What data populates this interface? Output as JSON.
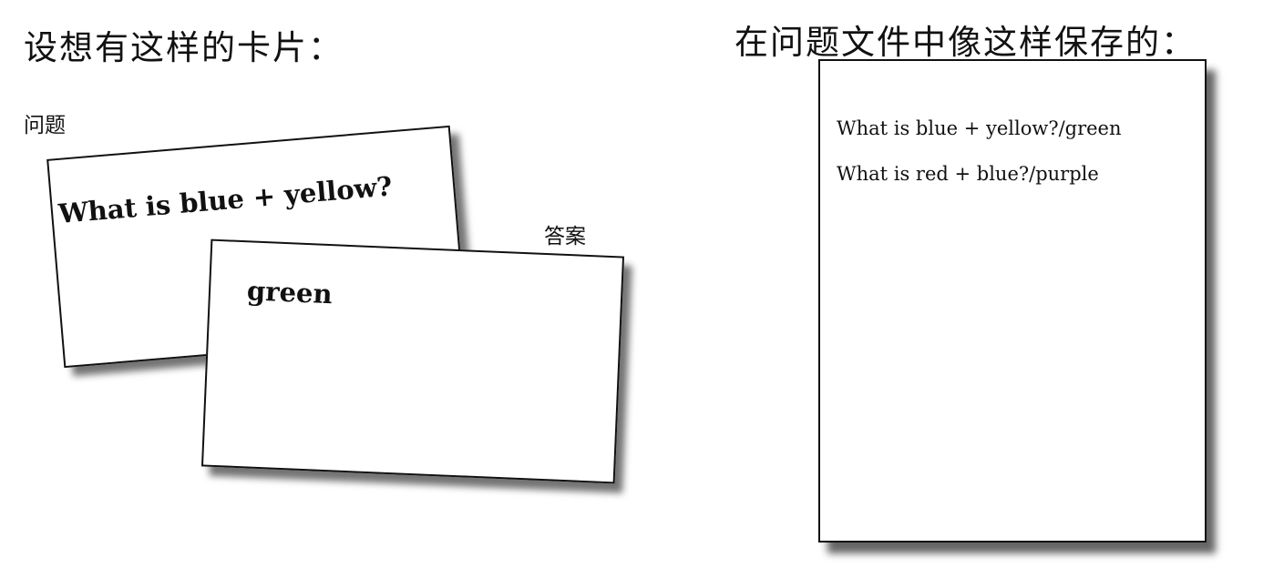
{
  "headings": {
    "left": "设想有这样的卡片：",
    "right": "在问题文件中像这样保存的："
  },
  "labels": {
    "question": "问题",
    "answer": "答案"
  },
  "cards": {
    "question_text": "What is blue + yellow?",
    "answer_text": "green"
  },
  "file": {
    "lines": [
      "What is blue + yellow?/green",
      "What is red + blue?/purple"
    ]
  }
}
